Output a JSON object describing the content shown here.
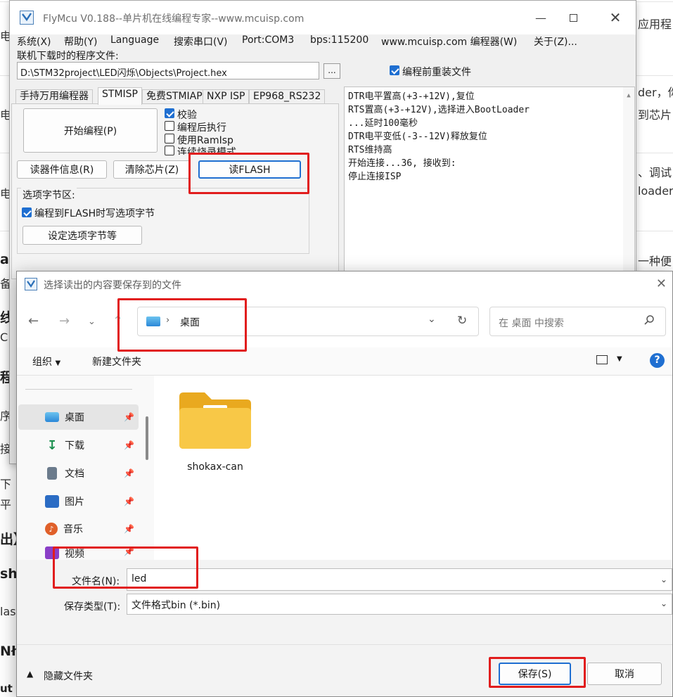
{
  "background": {
    "fragments_right": [
      "应用程",
      "der，你",
      "到芯片",
      "、调试",
      "loader",
      "一种便"
    ],
    "fragments_left": [
      "电",
      "电",
      "电",
      "ad",
      "备]",
      "线",
      "C",
      "程",
      "序",
      "接",
      "下",
      "平",
      "出】",
      "sh",
      "las",
      "Nł",
      "ut"
    ]
  },
  "flymcu": {
    "title": "FlyMcu V0.188--单片机在线编程专家--www.mcuisp.com",
    "menu": [
      "系统(X)",
      "帮助(Y)",
      "Language",
      "搜索串口(V)",
      "Port:COM3",
      "bps:115200",
      "www.mcuisp.com 编程器(W)",
      "关于(Z)..."
    ],
    "program_file_label": "联机下载时的程序文件:",
    "program_file_path": "D:\\STM32project\\LED闪烁\\Objects\\Project.hex",
    "browse_label": "...",
    "reload_before_program": "编程前重装文件",
    "tabs": [
      "手持万用编程器",
      "STMISP",
      "免费STMIAP",
      "NXP ISP",
      "EP968_RS232"
    ],
    "start_program": "开始编程(P)",
    "options": [
      "校验",
      "编程后执行",
      "使用RamIsp",
      "连续烧录模式"
    ],
    "read_device_info": "读器件信息(R)",
    "erase_chip": "清除芯片(Z)",
    "read_flash": "读FLASH",
    "option_bytes_group": "选项字节区:",
    "write_option_bytes": "编程到FLASH时写选项字节",
    "set_option_bytes": "设定选项字节等",
    "log": [
      "DTR电平置高(+3-+12V),复位",
      "RTS置高(+3-+12V),选择进入BootLoader",
      "...延时100毫秒",
      "DTR电平变低(-3--12V)释放复位",
      "RTS维持高",
      "开始连接...36, 接收到:",
      "停止连接ISP"
    ]
  },
  "dialog": {
    "title": "选择读出的内容要保存到的文件",
    "address_current": "桌面",
    "search_placeholder": "在 桌面 中搜索",
    "organize": "组织",
    "new_folder": "新建文件夹",
    "sidebar": [
      {
        "label": "桌面",
        "icon": "desktop-icon",
        "color": "#2b88d8"
      },
      {
        "label": "下载",
        "icon": "download-icon",
        "color": "#1b8f4e"
      },
      {
        "label": "文档",
        "icon": "document-icon",
        "color": "#6b7b8c"
      },
      {
        "label": "图片",
        "icon": "pictures-icon",
        "color": "#2b6cc4"
      },
      {
        "label": "音乐",
        "icon": "music-icon",
        "color": "#e0602a"
      },
      {
        "label": "视频",
        "icon": "video-icon",
        "color": "#8a3fc7"
      }
    ],
    "files": [
      {
        "name": "shokax-can",
        "type": "folder"
      }
    ],
    "filename_label": "文件名(N):",
    "filename_value": "led",
    "filetype_label": "保存类型(T):",
    "filetype_value": "文件格式bin (*.bin)",
    "hide_folders": "隐藏文件夹",
    "save": "保存(S)",
    "cancel": "取消"
  },
  "colors": {
    "highlight": "#e11d1d",
    "accent": "#1f6fd1",
    "folder": "#f5c341"
  }
}
